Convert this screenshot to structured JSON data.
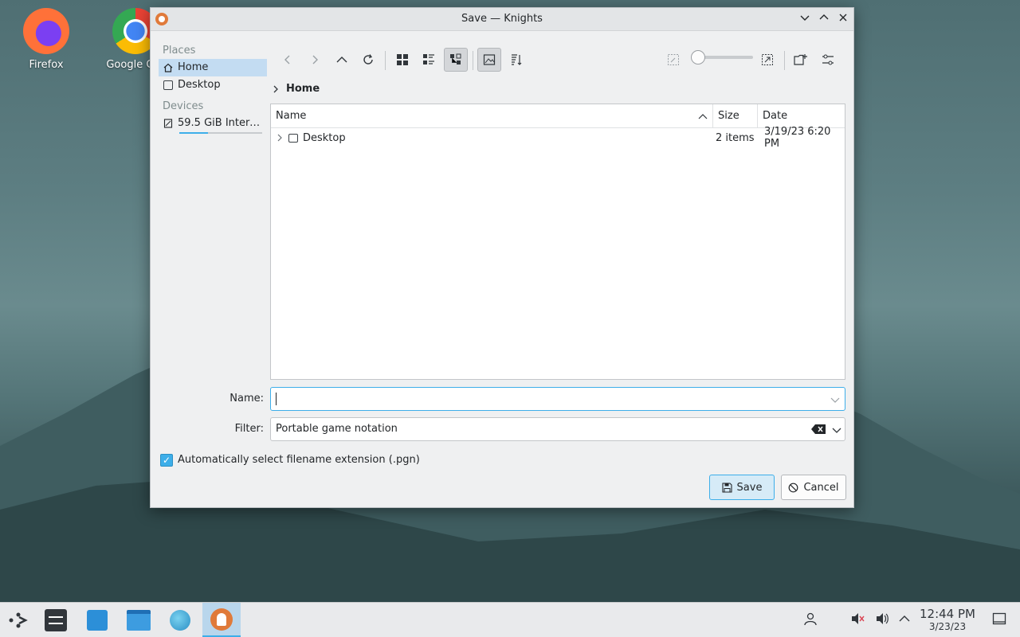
{
  "desktop": {
    "icons": [
      {
        "label": "Firefox"
      },
      {
        "label": "Google Ch"
      }
    ]
  },
  "window": {
    "title": "Save — Knights"
  },
  "sidebar": {
    "places_heading": "Places",
    "places": [
      {
        "label": "Home",
        "active": true
      },
      {
        "label": "Desktop",
        "active": false
      }
    ],
    "devices_heading": "Devices",
    "devices": [
      {
        "label": "59.5 GiB Intern...",
        "usage_fraction": 0.35
      }
    ]
  },
  "breadcrumb": {
    "current": "Home"
  },
  "file_view": {
    "columns": [
      "Name",
      "Size",
      "Date"
    ],
    "rows": [
      {
        "name": "Desktop",
        "size": "2 items",
        "date": "3/19/23 6:20 PM"
      }
    ]
  },
  "form": {
    "name_label": "Name:",
    "name_value": "",
    "filter_label": "Filter:",
    "filter_value": "Portable game notation",
    "auto_ext_label": "Automatically select filename extension (.pgn)",
    "auto_ext_checked": true,
    "save_label": "Save",
    "cancel_label": "Cancel"
  },
  "taskbar": {
    "time": "12:44 PM",
    "date": "3/23/23"
  },
  "colors": {
    "accent": "#3daee9",
    "selection": "#c3dcf2"
  }
}
